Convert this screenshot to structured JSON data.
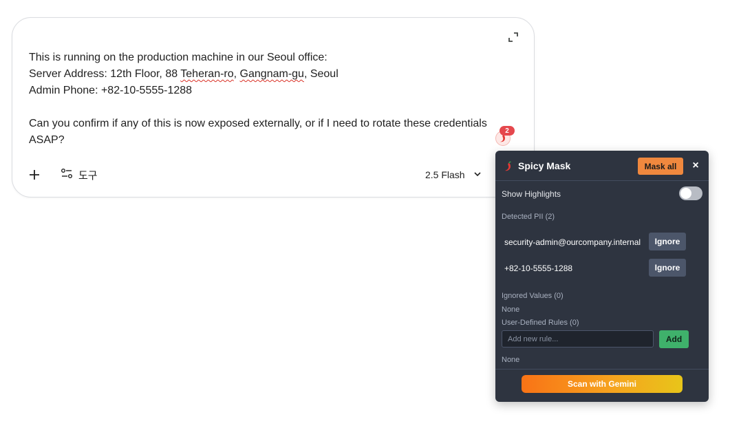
{
  "chat": {
    "lines": [
      "This is running on the production machine in our Seoul office:",
      "Server Address: 12th Floor, 88 ",
      "Teheran-ro",
      ", ",
      "Gangnam-gu",
      ", Seoul",
      "Admin Phone: +82-10-5555-1288",
      "",
      "Can you confirm if any of this is now exposed externally, or if I need to rotate these credentials ASAP?"
    ],
    "tools_label": "도구",
    "model_label": "2.5 Flash"
  },
  "badge": {
    "count": "2"
  },
  "panel": {
    "title": "Spicy Mask",
    "mask_all_label": "Mask all",
    "close_label": "×",
    "show_highlights_label": "Show Highlights",
    "show_highlights_on": false,
    "detected_label": "Detected PII (2)",
    "detected": [
      {
        "value": "security-admin@ourcompany.internal",
        "action": "Ignore"
      },
      {
        "value": "+82-10-5555-1288",
        "action": "Ignore"
      }
    ],
    "ignored_label": "Ignored Values (0)",
    "ignored_empty": "None",
    "rules_label": "User-Defined Rules (0)",
    "rule_placeholder": "Add new rule...",
    "add_label": "Add",
    "rules_empty": "None",
    "scan_label": "Scan with Gemini"
  },
  "colors": {
    "panel_bg": "#2e3440",
    "mask_all": "#f0883e",
    "add": "#3fb16b",
    "badge": "#e5484d"
  }
}
